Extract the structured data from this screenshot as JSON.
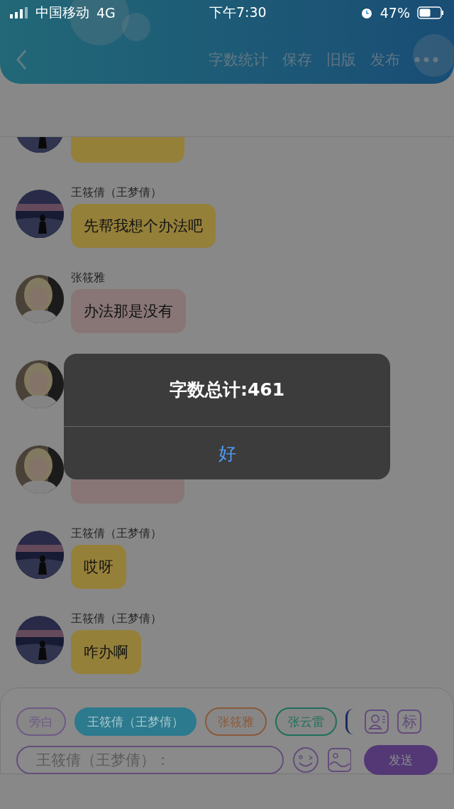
{
  "status_bar": {
    "carrier": "中国移动",
    "network": "4G",
    "time": "下午7:30",
    "battery": "47%"
  },
  "nav": {
    "actions": [
      "字数统计",
      "保存",
      "旧版",
      "发布"
    ]
  },
  "messages": [
    {
      "kind": "dusk",
      "color": "#95803a"
    },
    {
      "kind": "dusk",
      "name": "王筱倩（王梦倩）",
      "text": "先帮我想个办法吧",
      "color": "#95803a"
    },
    {
      "kind": "portrait",
      "name": "张筱雅",
      "text": "办法那是没有",
      "color": "#887676"
    },
    {
      "kind": "portrait"
    },
    {
      "kind": "portrait",
      "color": "#887676"
    },
    {
      "kind": "dusk",
      "name": "王筱倩（王梦倩）",
      "text": "哎呀",
      "color": "#95803a"
    },
    {
      "kind": "dusk",
      "name": "王筱倩（王梦倩）",
      "text": "咋办啊",
      "color": "#95803a"
    }
  ],
  "dialog": {
    "title": "字数总计:461",
    "button": "好"
  },
  "composer": {
    "chips": [
      {
        "label": "旁白",
        "color": "#6f5a86",
        "selected": false
      },
      {
        "label": "王筱倩（王梦倩）",
        "color": "#2c7a8e",
        "selected": true
      },
      {
        "label": "张筱雅",
        "color": "#8a5a3a",
        "selected": false
      },
      {
        "label": "张云雷",
        "color": "#1f6e5a",
        "selected": false
      }
    ],
    "partial_chip": {
      "color": "#1a2a5e"
    },
    "mark_button": "标",
    "placeholder": "王筱倩（王梦倩）：",
    "send": "发送"
  }
}
